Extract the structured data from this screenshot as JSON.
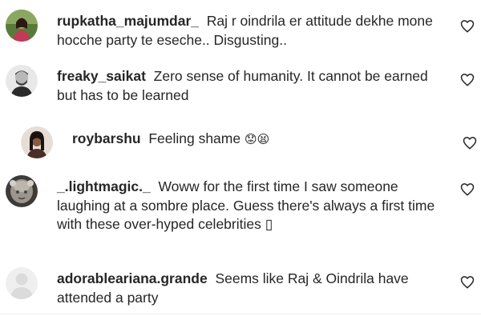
{
  "comments": [
    {
      "username": "rupkatha_majumdar_",
      "text": "Raj r oindrila er attitude dekhe mone hocche party te eseche.. Disgusting..",
      "avatar": "profile-photo-woman"
    },
    {
      "username": "freaky_saikat",
      "text": "Zero sense of humanity. It cannot be earned but has to be learned",
      "avatar": "profile-photo-man"
    },
    {
      "username": "roybarshu",
      "text": "Feeling shame",
      "emoji": "😟😫",
      "avatar": "profile-photo-woman"
    },
    {
      "username": "_.lightmagic._",
      "text": "Woww for the first time I saw someone laughing at a sombre place. Guess there's always a first time with these over-hyped celebrities",
      "emoji": "▯",
      "avatar": "profile-photo-statue"
    },
    {
      "username": "adorableariana.grande",
      "text": "Seems like Raj & Oindrila have attended a party",
      "avatar": "default-avatar"
    }
  ],
  "icons": {
    "like": "heart-outline-icon"
  },
  "colors": {
    "text": "#262626",
    "background": "#ffffff",
    "default_avatar": "#dbdbdb"
  }
}
